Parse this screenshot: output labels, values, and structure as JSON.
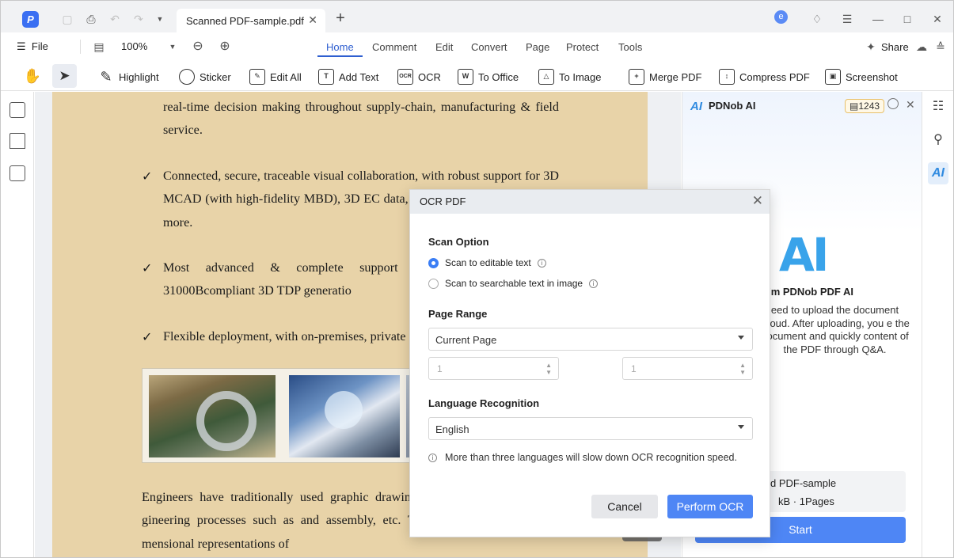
{
  "titlebar": {
    "tab_title": "Scanned PDF-sample.pdf",
    "avatar_letter": "e"
  },
  "menubar": {
    "file_label": "File",
    "zoom": "100%",
    "tabs": [
      "Home",
      "Comment",
      "Edit",
      "Convert",
      "Page",
      "Protect",
      "Tools"
    ],
    "share_label": "Share"
  },
  "toolbar": {
    "highlight": "Highlight",
    "sticker": "Sticker",
    "edit_all": "Edit All",
    "add_text": "Add Text",
    "ocr": "OCR",
    "ocr_icon_text": "OCR",
    "to_office": "To Office",
    "to_image": "To Image",
    "merge_pdf": "Merge PDF",
    "compress_pdf": "Compress PDF",
    "screenshot": "Screenshot"
  },
  "document": {
    "para1": "real-time decision making throughout supply-chain, manufacturing & field service.",
    "bullet1": "Connected, secure, traceable visual collaboration, with robust support for 3D MCAD (with high-fidelity MBD), 3D EC data, text, video, audio, images & more.",
    "bullet2": "Most advanced & complete support for automat MIL-STD-31000Bcompliant 3D TDP generatio",
    "bullet3": "Flexible deployment, with on-premises, private",
    "para2": "Engineers have traditionally used graphic drawing define a product for en-gineering processes such as and assembly, etc. These drawings are two-di-mensional representations of",
    "checkmark": "✓"
  },
  "ai_panel": {
    "title": "PDNob AI",
    "credits": "1243",
    "big_logo": "AI",
    "greeting": "I'm PDNob PDF AI",
    "description": "eed to upload the document Cloud. After uploading, you e the document and quickly content of the PDF through Q&A.",
    "file_name": "d PDF-sample",
    "file_info": "kB · 1Pages",
    "start_label": "Start"
  },
  "modal": {
    "title": "OCR PDF",
    "scan_option_title": "Scan Option",
    "scan_editable": "Scan to editable text",
    "scan_searchable": "Scan to searchable text in image",
    "page_range_title": "Page Range",
    "page_range_value": "Current Page",
    "from_page": "1",
    "to_page": "1",
    "language_title": "Language Recognition",
    "language_value": "English",
    "note": "More than three languages will slow down OCR recognition speed.",
    "cancel_label": "Cancel",
    "perform_label": "Perform OCR"
  },
  "colors": {
    "accent": "#4e86f5",
    "page_background": "#e8d3a8",
    "ai_blue": "#39a3ea"
  }
}
